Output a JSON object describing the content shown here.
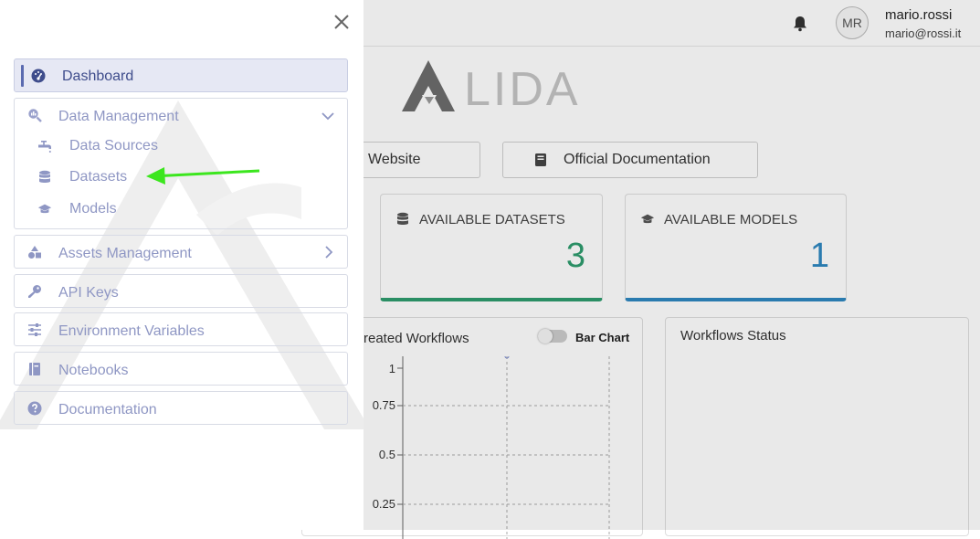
{
  "header": {
    "user_initials": "MR",
    "user_name": "mario.rossi",
    "user_email": "mario@rossi.it",
    "icons": [
      "bell-icon"
    ]
  },
  "brand": {
    "logo_text": "LIDA"
  },
  "links": {
    "website_label": "Website",
    "docs_label": "Official Documentation"
  },
  "stats": {
    "datasets": {
      "label": "AVAILABLE DATASETS",
      "value": "3",
      "color": "#2e9c6e"
    },
    "models": {
      "label": "AVAILABLE MODELS",
      "value": "1",
      "color": "#2f87c0"
    }
  },
  "workflows_panel": {
    "title": "reated Workflows",
    "toggle_label": "Bar Chart",
    "y_ticks": [
      "1",
      "0.75",
      "0.5",
      "0.25"
    ]
  },
  "status_panel": {
    "title": "Workflows Status"
  },
  "sidebar": {
    "dashboard": "Dashboard",
    "data_management": {
      "label": "Data Management",
      "items": [
        {
          "label": "Data Sources",
          "icon": "faucet-icon"
        },
        {
          "label": "Datasets",
          "icon": "database-icon"
        },
        {
          "label": "Models",
          "icon": "graduation-cap-icon"
        }
      ]
    },
    "assets": "Assets Management",
    "api_keys": "API Keys",
    "env_vars": "Environment Variables",
    "notebooks": "Notebooks",
    "documentation": "Documentation"
  },
  "colors": {
    "accent": "#5b6bb0",
    "menu_text": "#8f97c4",
    "active_bg": "#e6e8f4",
    "annotation_arrow": "#3ce61e"
  }
}
